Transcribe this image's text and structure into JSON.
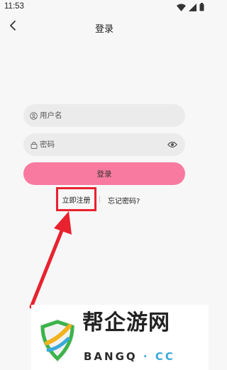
{
  "status_bar": {
    "time": "11:53",
    "icons": [
      "wifi-icon",
      "cellular-signal-icon",
      "battery-icon"
    ]
  },
  "header": {
    "back_icon": "chevron-left-icon",
    "title": "登录"
  },
  "form": {
    "username_placeholder": "用户名",
    "username_value": "",
    "username_icon": "user-icon",
    "password_placeholder": "密码",
    "password_value": "",
    "password_icon": "lock-icon",
    "toggle_icon": "eye-icon",
    "login_label": "登录",
    "register_label": "立即注册",
    "forgot_label": "忘记密码?"
  },
  "annotation": {
    "highlight_color": "#e8222e",
    "arrow_color": "#e8222e"
  },
  "watermark": {
    "brand": "帮企游网",
    "domain_main": "BANGQ",
    "domain_dot": "·",
    "domain_tld": "CC"
  },
  "colors": {
    "accent": "#f87aa0",
    "field_bg": "#ebebeb",
    "page_bg": "#f7f7f7"
  }
}
